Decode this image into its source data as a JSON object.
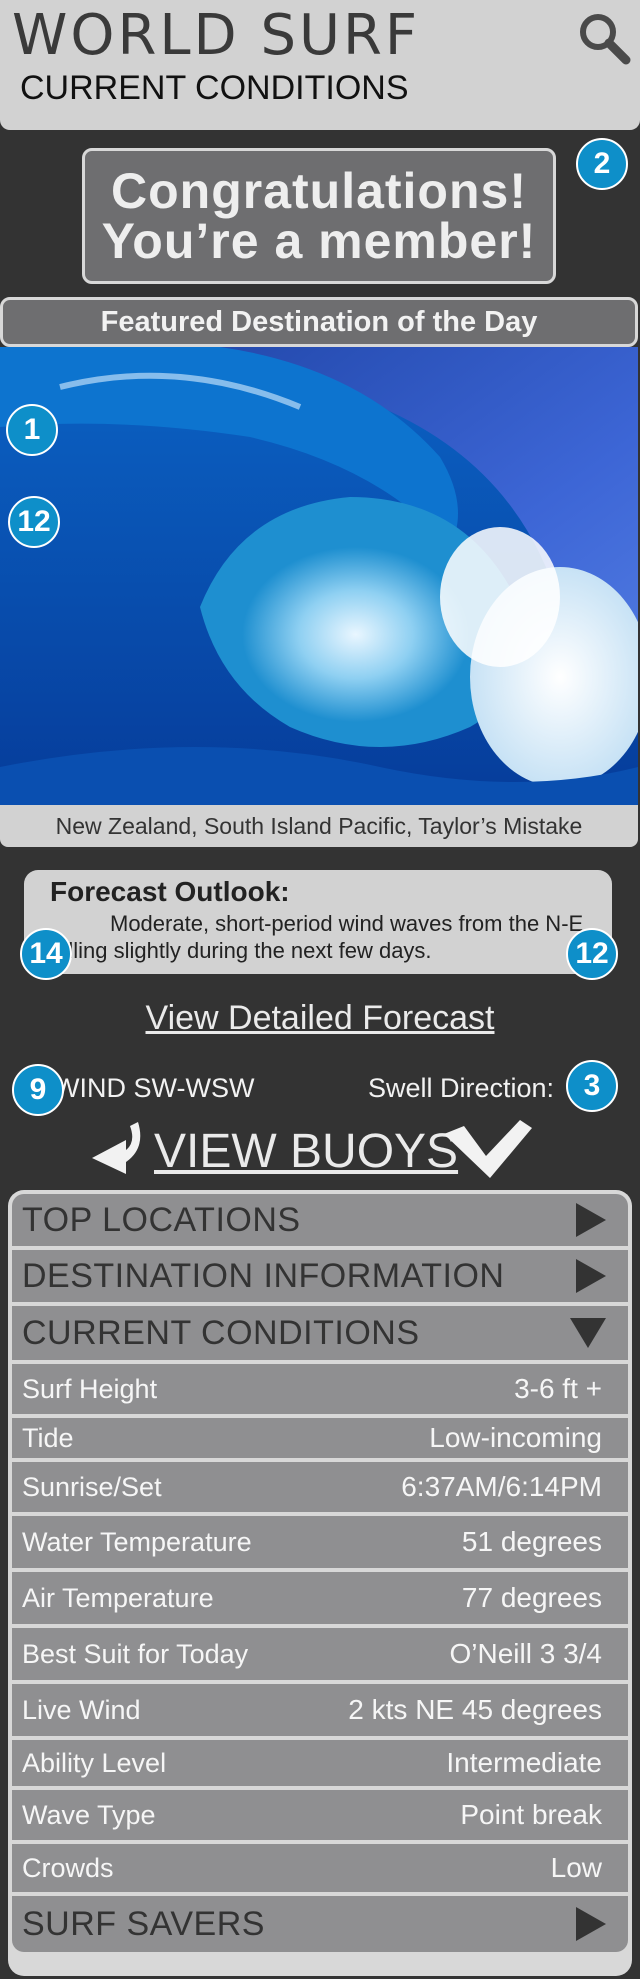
{
  "header": {
    "brand": "WORLD SURF",
    "subtitle": "CURRENT CONDITIONS"
  },
  "badges": {
    "b_congrats": "2",
    "b_wave_1": "1",
    "b_wave_2": "12",
    "b_forecast_left": "14",
    "b_forecast_right": "12",
    "b_wind": "9",
    "b_swell": "3"
  },
  "congrats": {
    "line1": "Congratulations!",
    "line2": "You’re a member!"
  },
  "featured": {
    "title": "Featured Destination of the Day",
    "location": "New Zealand, South Island Pacific, Taylor’s Mistake"
  },
  "forecast": {
    "title": "Forecast Outlook:",
    "text": "Moderate, short-period wind waves from the N-E falling slightly during the next few days."
  },
  "links": {
    "detailed_forecast": "View Detailed Forecast",
    "view_buoys": "VIEW BUOYS"
  },
  "wind": {
    "label": "WIND SW-WSW"
  },
  "swell": {
    "label": "Swell Direction:"
  },
  "sections": {
    "top_locations": "TOP LOCATIONS",
    "destination_info": "DESTINATION INFORMATION",
    "current_conditions": "CURRENT CONDITIONS",
    "surf_savers": "SURF SAVERS"
  },
  "conditions": [
    {
      "label": "Surf Height",
      "value": "3-6 ft +"
    },
    {
      "label": "Tide",
      "value": "Low-incoming"
    },
    {
      "label": "Sunrise/Set",
      "value": "6:37AM/6:14PM"
    },
    {
      "label": "Water Temperature",
      "value": "51 degrees"
    },
    {
      "label": "Air Temperature",
      "value": "77 degrees"
    },
    {
      "label": "Best Suit for Today",
      "value": "O’Neill 3 3/4"
    },
    {
      "label": "Live Wind",
      "value": "2 kts NE 45 degrees"
    },
    {
      "label": "Ability Level",
      "value": "Intermediate"
    },
    {
      "label": "Wave Type",
      "value": "Point break"
    },
    {
      "label": "Crowds",
      "value": "Low"
    }
  ],
  "colors": {
    "background": "#333333",
    "panel": "#d2d2d2",
    "accent_badge": "#0e8fc9",
    "row": "#8f8f91"
  },
  "icons": {
    "search": "search-icon",
    "arrow_left": "curved-arrow-left-icon",
    "arrow_right": "check-arrow-right-icon"
  }
}
